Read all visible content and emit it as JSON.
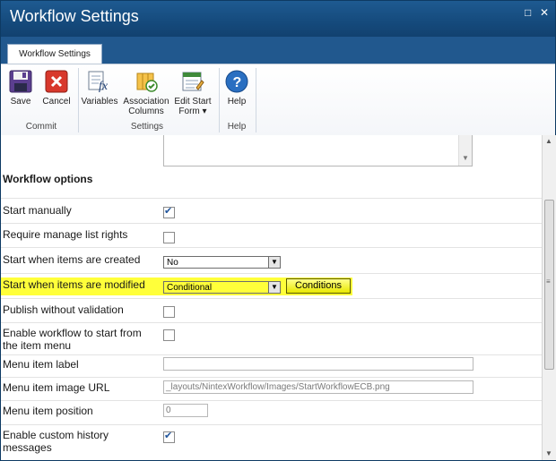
{
  "window": {
    "title": "Workflow Settings",
    "restore_icon": "□",
    "close_icon": "✕"
  },
  "ribbon": {
    "tab_label": "Workflow Settings",
    "buttons": {
      "save": "Save",
      "cancel": "Cancel",
      "variables": "Variables",
      "association_1": "Association",
      "association_2": "Columns",
      "edit_start_1": "Edit Start",
      "edit_start_2": "Form ▾",
      "help": "Help"
    },
    "groups": {
      "commit": "Commit",
      "settings": "Settings",
      "help": "Help"
    }
  },
  "options": {
    "heading": "Workflow options",
    "start_manually": {
      "label": "Start manually",
      "checked": true
    },
    "require_rights": {
      "label": "Require manage list rights",
      "checked": false
    },
    "start_created": {
      "label": "Start when items are created",
      "value": "No"
    },
    "start_modified": {
      "label": "Start when items are modified",
      "value": "Conditional",
      "button": "Conditions"
    },
    "publish_without_validation": {
      "label": "Publish without validation",
      "checked": false
    },
    "enable_item_menu": {
      "label_1": "Enable workflow to start from",
      "label_2": "the item menu",
      "checked": false
    },
    "menu_item_label": {
      "label": "Menu item label",
      "value": ""
    },
    "menu_item_image_url": {
      "label": "Menu item image URL",
      "value": "_layouts/NintexWorkflow/Images/StartWorkflowECB.png"
    },
    "menu_item_position": {
      "label": "Menu item position",
      "value": "0"
    },
    "custom_history": {
      "label_1": "Enable custom history",
      "label_2": "messages",
      "checked": true
    }
  },
  "colors": {
    "title_bar": "#1b4f86",
    "highlight": "#ffff33"
  }
}
